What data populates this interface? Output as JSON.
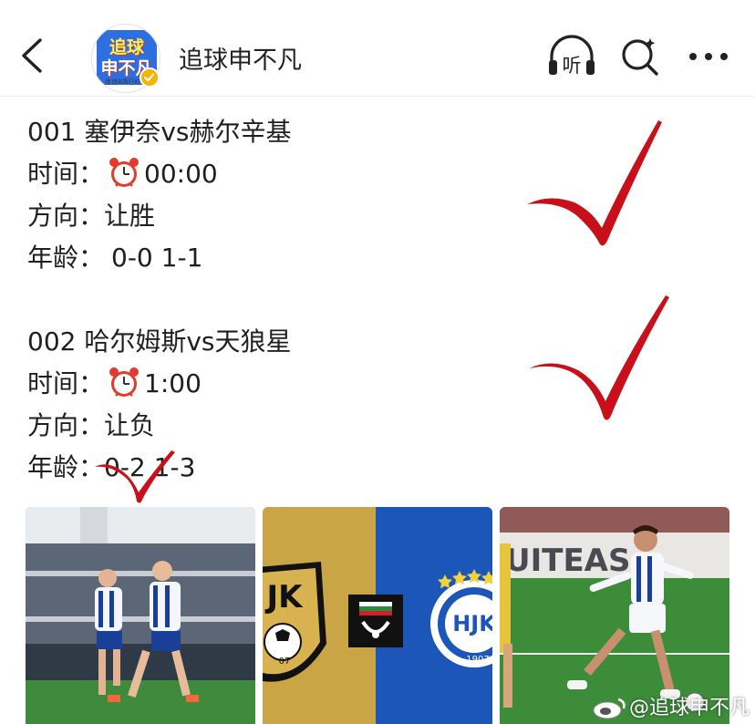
{
  "header": {
    "account_name": "追球申不凡",
    "avatar_text_top": "追球",
    "avatar_text_bottom": "申不凡",
    "avatar_caption": "连追8场已红",
    "listen_label": "听"
  },
  "matches": [
    {
      "number": "001",
      "teams": "塞伊奈vs赫尔辛基",
      "time_label": "时间：",
      "time": "00:00",
      "direction_label": "方向：",
      "direction": "让胜",
      "age_label": "年龄：",
      "age": "0-0 1-1"
    },
    {
      "number": "002",
      "teams": "哈尔姆斯vs天狼星",
      "time_label": "时间：",
      "time": "1:00",
      "direction_label": "方向：",
      "direction": "让负",
      "age_label": "年龄：",
      "age": "0-2 1-3"
    }
  ],
  "images": {
    "badge_left_text": "JK",
    "badge_left_year": "07",
    "badge_right_text": "HJK",
    "badge_right_year": "1907",
    "banner_text": "UITEASa"
  },
  "watermark": "@追球申不凡",
  "colors": {
    "check_red": "#c8101a",
    "gold_panel": "#c9a545",
    "blue_panel": "#1c56b8"
  }
}
